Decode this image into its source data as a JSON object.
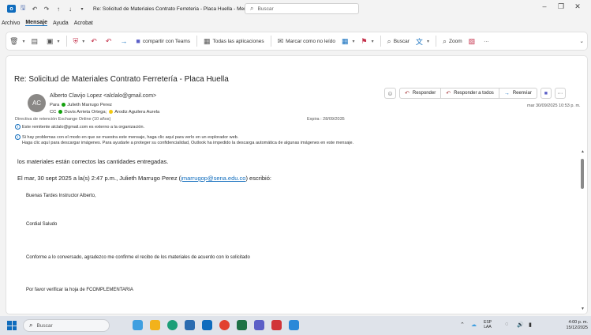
{
  "window": {
    "title": "Re: Solicitud de Materiales Contrato Ferreteria - Placa Huella  -  Mensaje (HT...",
    "search_placeholder": "Buscar"
  },
  "menu": [
    "Archivo",
    "Mensaje",
    "Ayuda",
    "Acrobat"
  ],
  "ribbon": {
    "teams": "compartir con Teams",
    "apps": "Todas las aplicaciones",
    "unread": "Marcar como no leído",
    "search": "Buscar",
    "zoom": "Zoom",
    "more": "···"
  },
  "email": {
    "subject": "Re: Solicitud de Materiales Contrato Ferretería - Placa Huella",
    "avatar_initials": "AC",
    "from": "Alberto Clavijo Lopez <alclalo@gmail.com>",
    "to_label": "Para",
    "to": "Julieth Marrugo Perez",
    "cc_label": "CC",
    "cc1": "Duvis Arrieta Ortega;",
    "cc2": "Arodiz Aguilera Aurela",
    "retention": "Directiva de retención  Exchange Online (10 años)",
    "expira": "Expira : 28/09/2035",
    "external_notice": "Este remitente alclalo@gmail.com es externo a la organización.",
    "problem_notice": "Si hay problemas con el modo en que se muestra este mensaje, haga clic aquí para verlo en un explorador web.",
    "download_notice": "Haga clic aquí para descargar imágenes. Para ayudarle a proteger su confidencialidad, Outlook ha impedido la descarga automática de algunas imágenes en este mensaje.",
    "date": "mar 30/09/2025 10:53 p. m.",
    "reply": "Responder",
    "reply_all": "Responder a todos",
    "forward": "Reenviar",
    "more": "···",
    "body_line1": "los materiales están correctos las cantidades entregadas.",
    "body_line2_prefix": "El mar, 30 sept 2025 a la(s) 2:47 p.m., Julieth Marrugo Perez (",
    "body_line2_link": "jmarrugop@sena.edu.co",
    "body_line2_suffix": ") escribió:",
    "quote": [
      "Buenas Tardes Instructor Alberto,",
      "Cordial Saludo",
      "Conforme a lo conversado, agradezco me confirme el recibo de los materiales de acuerdo con lo solicitado",
      "Por favor verificar la hoja de FCOMPLEMENTARIA"
    ]
  },
  "taskbar": {
    "search": "Buscar",
    "lang1": "ESP",
    "lang2": "LAA",
    "time": "4:00 p. m.",
    "date": "15/12/2025"
  }
}
